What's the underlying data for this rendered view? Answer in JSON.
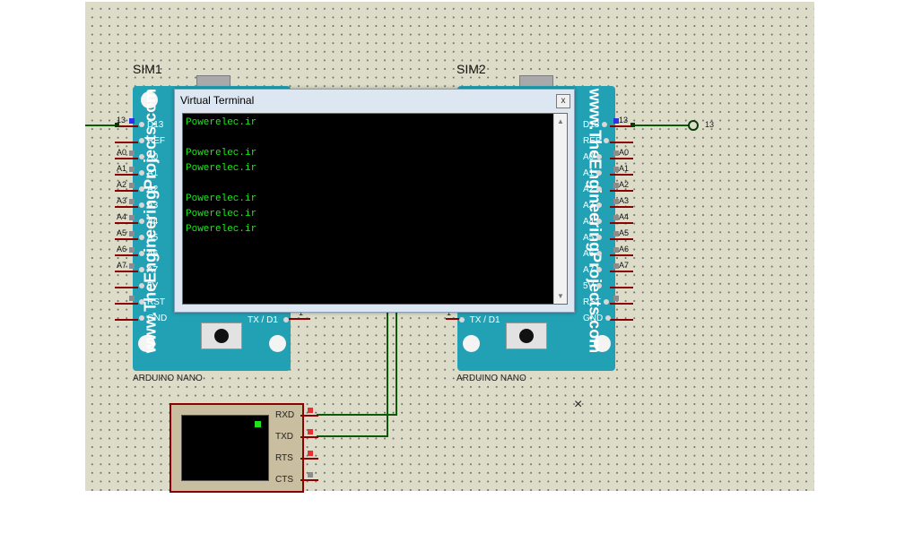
{
  "schematic": {
    "sim1_label": "SIM1",
    "sim2_label": "SIM2",
    "board_part_1": "ARDUINO NANO",
    "board_part_2": "ARDUINO NANO",
    "board_brand": "www.TheEngineeringProjects.com",
    "left_pins": [
      "D13",
      "REF",
      "A0",
      "A1",
      "A2",
      "A3",
      "A4",
      "A5",
      "A6",
      "A7",
      "5V",
      "RST",
      "GND"
    ],
    "right_pins": [
      "D13",
      "REF",
      "A0",
      "A1",
      "A2",
      "A3",
      "A4",
      "A5",
      "A6",
      "A7",
      "5V",
      "RST",
      "GND"
    ],
    "ext_labels_left": [
      "13",
      "",
      "A0",
      "A1",
      "A2",
      "A3",
      "A4",
      "A5",
      "A6",
      "A7",
      "",
      "",
      ""
    ],
    "ext_labels_right": [
      "13",
      "",
      "A0",
      "A1",
      "A2",
      "A3",
      "A4",
      "A5",
      "A6",
      "A7",
      "",
      "",
      ""
    ],
    "txd_pin_label_1": "TX / D1",
    "txd_pin_label_2": "TX / D1",
    "txd_pin_num_1": "1",
    "txd_pin_num_2": "1",
    "probe_label": "13"
  },
  "virtual_terminal": {
    "title": "Virtual Terminal",
    "close_glyph": "x",
    "lines": [
      "Powerelec.ir",
      "",
      "Powerelec.ir",
      "Powerelec.ir",
      "",
      "Powerelec.ir",
      "Powerelec.ir",
      "Powerelec.ir"
    ],
    "text_color": "#1ee81e"
  },
  "terminal_component": {
    "pins": [
      "RXD",
      "TXD",
      "RTS",
      "CTS"
    ]
  },
  "colors": {
    "board": "#21a1b3",
    "wire": "#0a5a0a",
    "lead": "#8b0000"
  }
}
